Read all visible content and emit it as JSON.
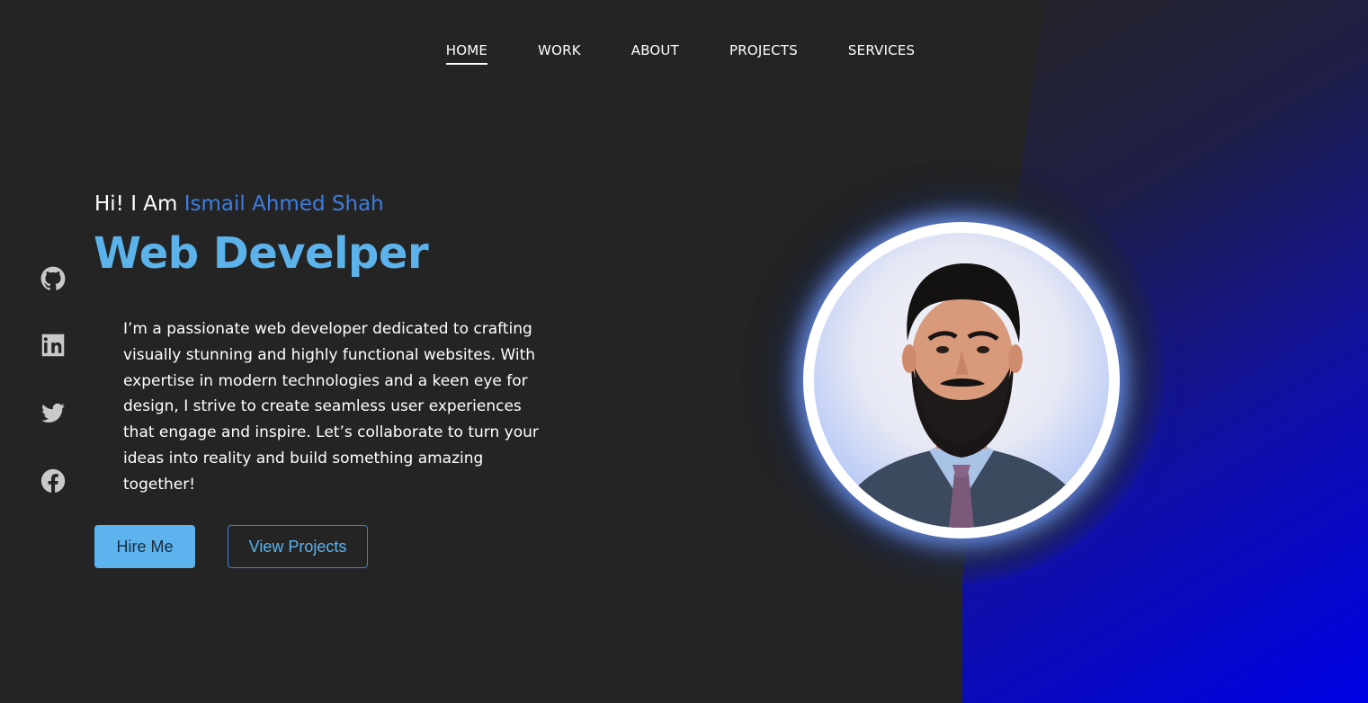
{
  "nav": {
    "items": [
      {
        "label": "HOME",
        "active": true
      },
      {
        "label": "WORK",
        "active": false
      },
      {
        "label": "ABOUT",
        "active": false
      },
      {
        "label": "PROJECTS",
        "active": false
      },
      {
        "label": "SERVICES",
        "active": false
      }
    ]
  },
  "social": {
    "icons": [
      "github-icon",
      "linkedin-icon",
      "twitter-icon",
      "facebook-icon"
    ],
    "icon_color": "#c9c9c9"
  },
  "hero": {
    "greeting_prefix": "Hi! I Am ",
    "name": "Ismail Ahmed Shah",
    "role": "Web Develper",
    "bio": "I’m a passionate web developer dedicated to crafting visually stunning and highly functional websites. With expertise in modern technologies and a keen eye for design, I strive to create seamless user experiences that engage and inspire. Let’s collaborate to turn your ideas into reality and build something amazing together!",
    "hire_button": "Hire Me",
    "projects_button": "View Projects"
  },
  "colors": {
    "background": "#242424",
    "accent_light": "#5cb3ee",
    "accent_dark": "#3d7de0",
    "gradient_end": "#0000ee"
  }
}
